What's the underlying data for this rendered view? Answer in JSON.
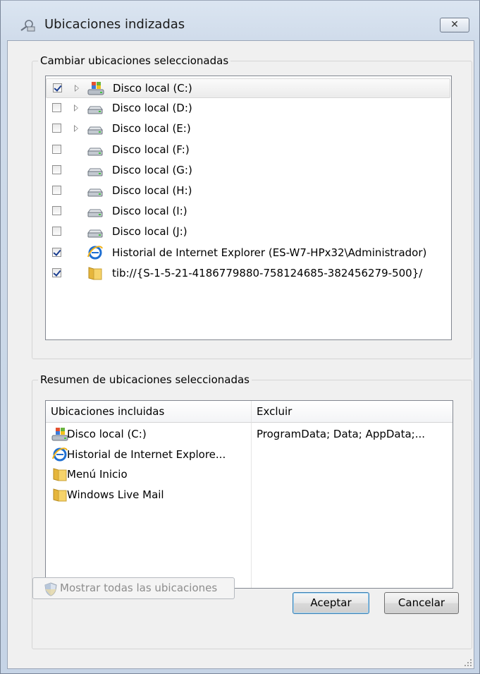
{
  "window": {
    "title": "Ubicaciones indizadas",
    "close_symbol": "✕"
  },
  "change_group": {
    "label": "Cambiar ubicaciones seleccionadas",
    "items": [
      {
        "label": "Disco local (C:)",
        "checked": true,
        "expandable": true,
        "icon": "windows-drive-icon",
        "selected": true
      },
      {
        "label": "Disco local (D:)",
        "checked": false,
        "expandable": true,
        "icon": "drive-icon"
      },
      {
        "label": "Disco local (E:)",
        "checked": false,
        "expandable": true,
        "icon": "drive-icon"
      },
      {
        "label": "Disco local (F:)",
        "checked": false,
        "expandable": false,
        "icon": "drive-icon"
      },
      {
        "label": "Disco local (G:)",
        "checked": false,
        "expandable": false,
        "icon": "drive-icon"
      },
      {
        "label": "Disco local (H:)",
        "checked": false,
        "expandable": false,
        "icon": "drive-icon"
      },
      {
        "label": "Disco local (I:)",
        "checked": false,
        "expandable": false,
        "icon": "drive-icon"
      },
      {
        "label": "Disco local (J:)",
        "checked": false,
        "expandable": false,
        "icon": "drive-icon"
      },
      {
        "label": "Historial de Internet Explorer (ES-W7-HPx32\\Administrador)",
        "checked": true,
        "expandable": false,
        "icon": "internet-explorer-icon"
      },
      {
        "label": "tib://{S-1-5-21-4186779880-758124685-382456279-500}/",
        "checked": true,
        "expandable": false,
        "icon": "folder-icon"
      }
    ]
  },
  "summary_group": {
    "label": "Resumen de ubicaciones seleccionadas",
    "columns": [
      "Ubicaciones incluidas",
      "Excluir"
    ],
    "rows": [
      {
        "included": "Disco local (C:)",
        "exclude": "ProgramData; Data; AppData;...",
        "icon": "windows-drive-icon"
      },
      {
        "included": "Historial de Internet Explore...",
        "exclude": "",
        "icon": "internet-explorer-icon"
      },
      {
        "included": "Menú Inicio",
        "exclude": "",
        "icon": "folder-icon"
      },
      {
        "included": "Windows Live Mail",
        "exclude": "",
        "icon": "folder-icon"
      }
    ]
  },
  "buttons": {
    "show_all": "Mostrar todas las ubicaciones",
    "ok": "Aceptar",
    "cancel": "Cancelar"
  },
  "colors": {
    "accent": "#1a3d8f",
    "title_bar": "#cfdbea"
  }
}
